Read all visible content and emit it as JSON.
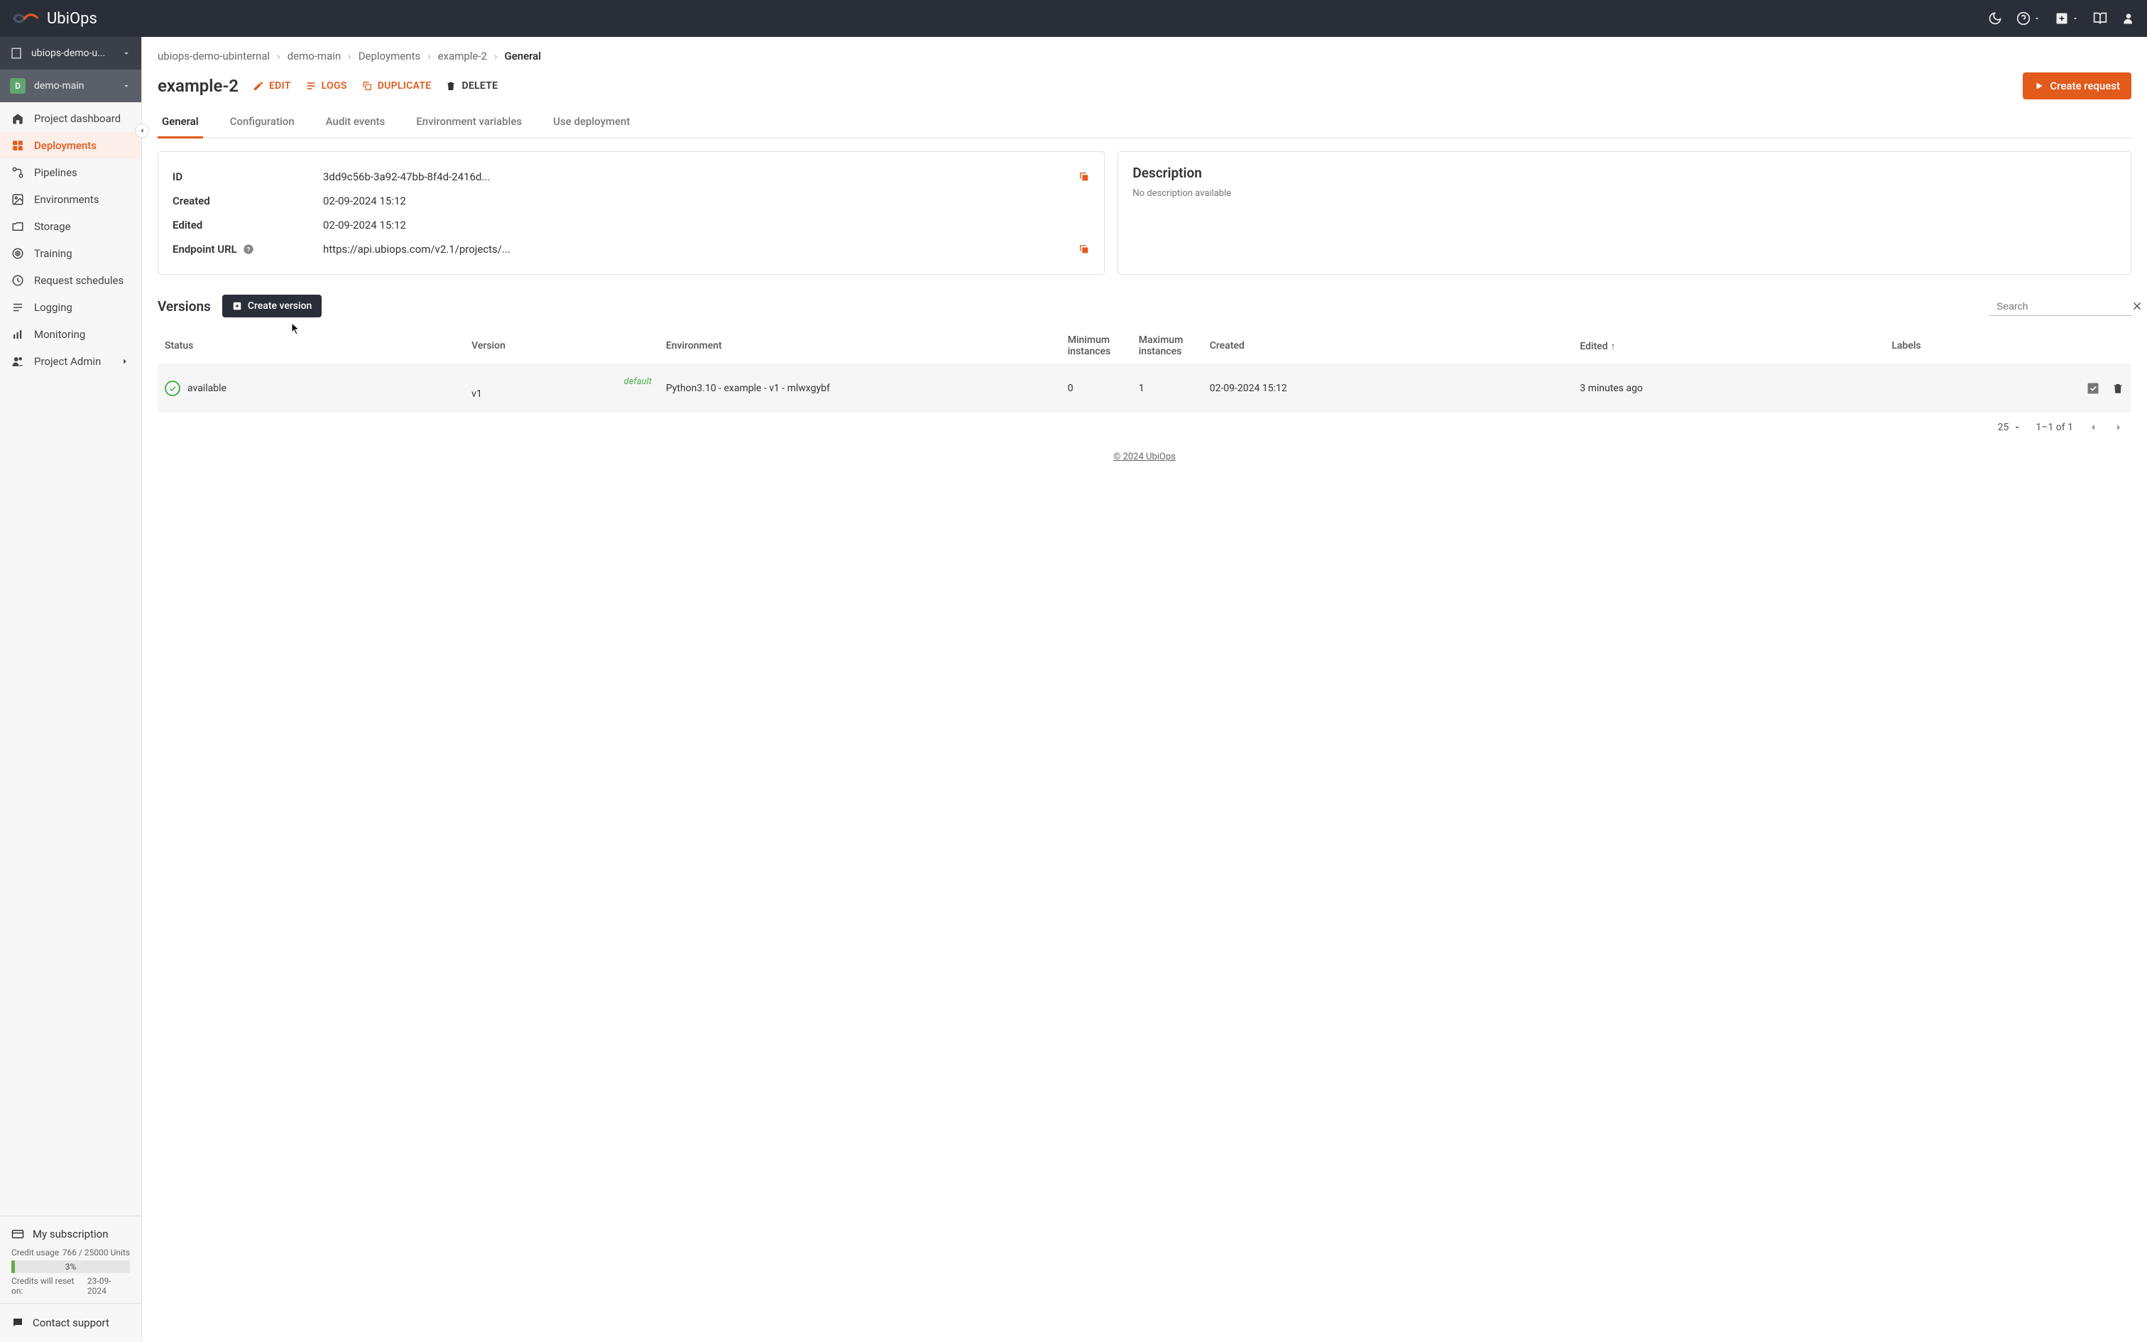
{
  "brand": "UbiOps",
  "sidebar": {
    "org": "ubiops-demo-u...",
    "project": "demo-main",
    "project_badge": "D",
    "items": [
      {
        "icon": "home",
        "label": "Project dashboard"
      },
      {
        "icon": "deployments",
        "label": "Deployments",
        "active": true
      },
      {
        "icon": "pipelines",
        "label": "Pipelines"
      },
      {
        "icon": "environments",
        "label": "Environments"
      },
      {
        "icon": "storage",
        "label": "Storage"
      },
      {
        "icon": "training",
        "label": "Training"
      },
      {
        "icon": "schedules",
        "label": "Request schedules"
      },
      {
        "icon": "logging",
        "label": "Logging"
      },
      {
        "icon": "monitoring",
        "label": "Monitoring"
      },
      {
        "icon": "admin",
        "label": "Project Admin",
        "chevron": true
      }
    ],
    "subscription_label": "My subscription",
    "credit_label": "Credit usage",
    "credit_value": "766 / 25000 Units",
    "progress_pct": "3%",
    "reset_label": "Credits will reset on:",
    "reset_date": "23-09-2024",
    "contact_label": "Contact support"
  },
  "breadcrumb": [
    "ubiops-demo-ubinternal",
    "demo-main",
    "Deployments",
    "example-2",
    "General"
  ],
  "page_title": "example-2",
  "actions": {
    "edit": "EDIT",
    "logs": "LOGS",
    "duplicate": "DUPLICATE",
    "delete": "DELETE"
  },
  "primary_action": "Create request",
  "tabs": [
    "General",
    "Configuration",
    "Audit events",
    "Environment variables",
    "Use deployment"
  ],
  "details": {
    "id_label": "ID",
    "id_value": "3dd9c56b-3a92-47bb-8f4d-2416d...",
    "created_label": "Created",
    "created_value": "02-09-2024 15:12",
    "edited_label": "Edited",
    "edited_value": "02-09-2024 15:12",
    "endpoint_label": "Endpoint URL",
    "endpoint_value": "https://api.ubiops.com/v2.1/projects/..."
  },
  "description": {
    "title": "Description",
    "body": "No description available"
  },
  "versions": {
    "title": "Versions",
    "create_label": "Create version",
    "search_placeholder": "Search",
    "columns": {
      "status": "Status",
      "version": "Version",
      "environment": "Environment",
      "min": "Minimum instances",
      "max": "Maximum instances",
      "created": "Created",
      "edited": "Edited",
      "labels": "Labels"
    },
    "row": {
      "status": "available",
      "default_tag": "default",
      "version": "v1",
      "environment": "Python3.10 - example - v1 - mlwxgybf",
      "min": "0",
      "max": "1",
      "created": "02-09-2024 15:12",
      "edited": "3 minutes ago"
    },
    "page_size": "25",
    "page_range": "1–1 of 1"
  },
  "footer": "© 2024 UbiOps"
}
